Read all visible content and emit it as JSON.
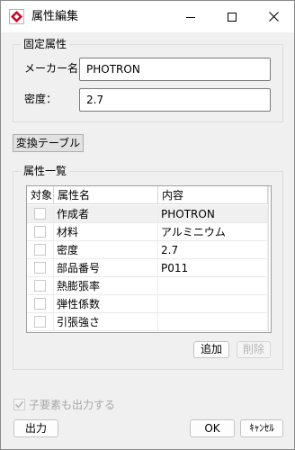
{
  "window": {
    "title": "属性編集",
    "app_icon": "red-diamond-icon"
  },
  "fixed_group": {
    "title": "固定属性",
    "maker_label": "メーカー名：",
    "maker_value": "PHOTRON",
    "density_label": "密度：",
    "density_value": "2.7"
  },
  "convert_table_button": "変換テーブル",
  "attr_group": {
    "title": "属性一覧",
    "columns": [
      "対象",
      "属性名",
      "内容"
    ],
    "rows": [
      {
        "checked": false,
        "name": "作成者",
        "value": "PHOTRON",
        "selected": true
      },
      {
        "checked": false,
        "name": "材料",
        "value": "アルミニウム",
        "selected": false
      },
      {
        "checked": false,
        "name": "密度",
        "value": "2.7",
        "selected": false
      },
      {
        "checked": false,
        "name": "部品番号",
        "value": "P011",
        "selected": false
      },
      {
        "checked": false,
        "name": "熱膨張率",
        "value": "",
        "selected": false
      },
      {
        "checked": false,
        "name": "弾性係数",
        "value": "",
        "selected": false
      },
      {
        "checked": false,
        "name": "引張強さ",
        "value": "",
        "selected": false
      }
    ],
    "add_button": "追加",
    "delete_button": "削除"
  },
  "output_children_checkbox": {
    "label": "子要素も出力する",
    "checked": true,
    "enabled": false
  },
  "footer": {
    "output_button": "出力",
    "ok_button": "OK",
    "cancel_button": "ｷｬﾝｾﾙ"
  },
  "colors": {
    "icon_red": "#d0021b",
    "selected_row": "#f0f0f0",
    "disabled_text": "#a8a8a8"
  }
}
